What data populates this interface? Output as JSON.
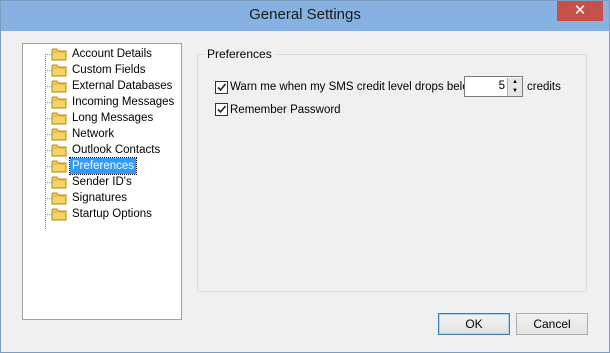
{
  "window": {
    "title": "General Settings",
    "close_glyph": "✕"
  },
  "tree": {
    "items": [
      {
        "label": "Account Details"
      },
      {
        "label": "Custom Fields"
      },
      {
        "label": "External Databases"
      },
      {
        "label": "Incoming Messages"
      },
      {
        "label": "Long Messages"
      },
      {
        "label": "Network"
      },
      {
        "label": "Outlook Contacts"
      },
      {
        "label": "Preferences",
        "selected": true
      },
      {
        "label": "Sender ID's"
      },
      {
        "label": "Signatures"
      },
      {
        "label": "Startup Options"
      }
    ],
    "icon": "folder-icon"
  },
  "preferences": {
    "group_title": "Preferences",
    "warn": {
      "checked": true,
      "label": "Warn me when my SMS credit level drops below",
      "value": "5",
      "unit": "credits"
    },
    "remember": {
      "checked": true,
      "label": "Remember Password"
    }
  },
  "buttons": {
    "ok": "OK",
    "cancel": "Cancel"
  },
  "colors": {
    "titlebar": "#86b1e0",
    "selection": "#3399ff",
    "close": "#c7504a"
  }
}
